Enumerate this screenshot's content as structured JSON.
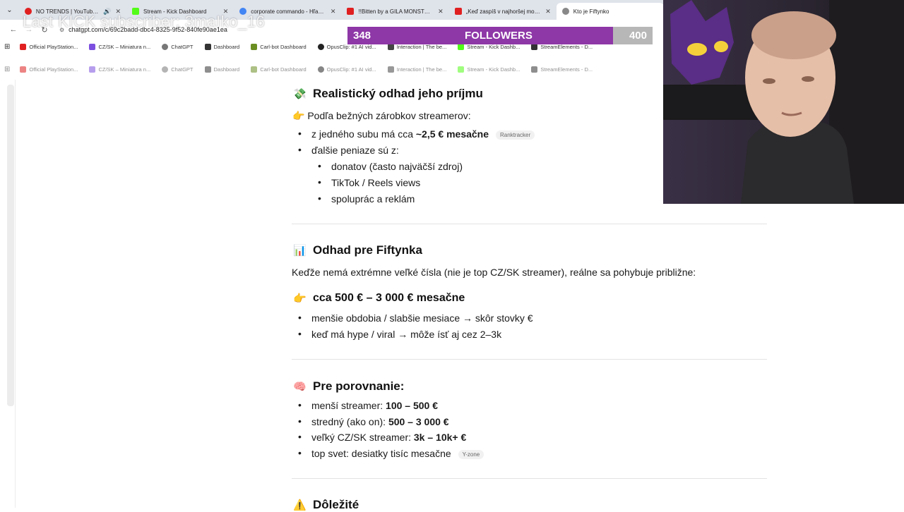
{
  "browser": {
    "tabs": [
      {
        "title": "NO TRENDS | YouTube Music",
        "color": "#e02020"
      },
      {
        "title": "Stream - Kick Dashboard",
        "color": "#53fc18"
      },
      {
        "title": "corporate commando - Hľadať",
        "color": "#4285f4"
      },
      {
        "title": "!!Bitten by a GILA MONSTER!! -",
        "color": "#e02020"
      },
      {
        "title": "„Keď zaspíš v najhoršej možnej",
        "color": "#e02020"
      },
      {
        "title": "Kto je Fiftynko",
        "color": "#888888"
      }
    ],
    "url": "chatgpt.com/c/69c2badd-dbc4-8325-9f52-840fe90ae1ea",
    "bookmarks": [
      "Official PlayStation...",
      "CZ/SK – Miniatura n...",
      "ChatGPT",
      "Dashboard",
      "Carl-bot Dashboard",
      "OpusClip: #1 AI vid...",
      "Interaction | The be...",
      "Stream - Kick Dashb...",
      "StreamElements - D..."
    ]
  },
  "overlay": {
    "kick_text": "Last KICK subscriber: 3maIko_16",
    "followers_current": "348",
    "followers_label": "FOLLOWERS",
    "followers_goal": "400",
    "followers_progress": 0.87
  },
  "article": {
    "section1": {
      "emoji": "💸",
      "heading": "Realistický odhad jeho príjmu",
      "intro_emoji": "👉",
      "intro": "Podľa bežných zárobkov streamerov:",
      "item1_pre": "z jedného subu má cca ",
      "item1_bold": "~2,5 € mesačne",
      "item1_pill": "Ranktracker",
      "item2": "ďalšie peniaze sú z:",
      "sub_items": [
        "donatov (často najväčší zdroj)",
        "TikTok / Reels views",
        "spoluprác a reklám"
      ]
    },
    "section2": {
      "emoji": "📊",
      "heading": "Odhad pre Fiftynka",
      "intro": "Keďže nemá extrémne veľké čísla (nie je top CZ/SK streamer), reálne sa pohybuje približne:",
      "range_emoji": "👉",
      "range": "cca 500 € – 3 000 € mesačne",
      "items": [
        "menšie obdobia / slabšie mesiace → skôr stovky €",
        "keď má hype / viral → môže ísť aj cez 2–3k"
      ]
    },
    "section3": {
      "emoji": "🧠",
      "heading": "Pre porovnanie:",
      "items": [
        {
          "pre": "menší streamer: ",
          "bold": "100 – 500 €"
        },
        {
          "pre": "stredný (ako on): ",
          "bold": "500 – 3 000 €"
        },
        {
          "pre": "veľký CZ/SK streamer: ",
          "bold": "3k – 10k+ €"
        },
        {
          "pre": "top svet: desiatky tisíc mesačne",
          "bold": "",
          "pill": "Y-zone"
        }
      ]
    },
    "section4": {
      "emoji": "⚠️",
      "heading": "Dôležité"
    }
  }
}
